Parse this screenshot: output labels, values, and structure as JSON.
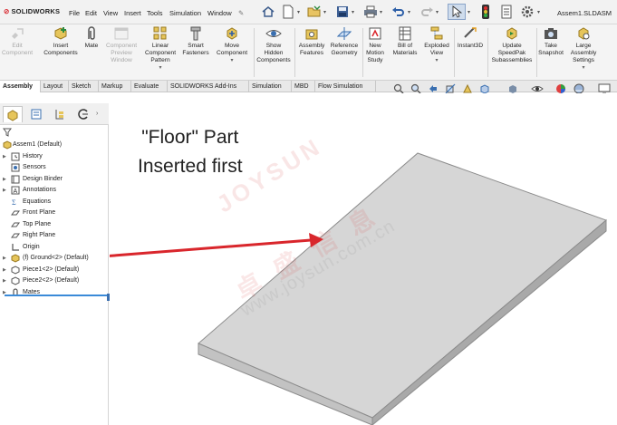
{
  "app": {
    "logo_text": "SOLIDWORKS",
    "document_title": "Assem1.SLDASM"
  },
  "menu": [
    "File",
    "Edit",
    "View",
    "Insert",
    "Tools",
    "Simulation",
    "Window"
  ],
  "ribbon": {
    "commands": [
      {
        "label": "Edit\nComponent",
        "enabled": false
      },
      {
        "label": "Insert\nComponents",
        "enabled": true
      },
      {
        "label": "Mate",
        "enabled": true
      },
      {
        "label": "Component\nPreview\nWindow",
        "enabled": false
      },
      {
        "label": "Linear\nComponent\nPattern",
        "enabled": true
      },
      {
        "label": "Smart\nFasteners",
        "enabled": true
      },
      {
        "label": "Move\nComponent",
        "enabled": true
      },
      {
        "label": "Show\nHidden\nComponents",
        "enabled": true
      },
      {
        "label": "Assembly\nFeatures",
        "enabled": true
      },
      {
        "label": "Reference\nGeometry",
        "enabled": true
      },
      {
        "label": "New\nMotion\nStudy",
        "enabled": true
      },
      {
        "label": "Bill of\nMaterials",
        "enabled": true
      },
      {
        "label": "Exploded\nView",
        "enabled": true
      },
      {
        "label": "Instant3D",
        "enabled": true
      },
      {
        "label": "Update\nSpeedPak\nSubassemblies",
        "enabled": true
      },
      {
        "label": "Take\nSnapshot",
        "enabled": true
      },
      {
        "label": "Large\nAssembly\nSettings",
        "enabled": true
      }
    ]
  },
  "tabs": [
    {
      "label": "Assembly",
      "active": true
    },
    {
      "label": "Layout",
      "active": false
    },
    {
      "label": "Sketch",
      "active": false
    },
    {
      "label": "Markup",
      "active": false
    },
    {
      "label": "Evaluate",
      "active": false
    },
    {
      "label": "SOLIDWORKS Add-Ins",
      "active": false
    },
    {
      "label": "Simulation",
      "active": false
    },
    {
      "label": "MBD",
      "active": false
    },
    {
      "label": "Flow Simulation",
      "active": false
    }
  ],
  "feature_tree": [
    {
      "label": "Assem1  (Default)",
      "icon": "assembly-icon",
      "expander": false
    },
    {
      "label": "History",
      "icon": "history-icon",
      "expander": true
    },
    {
      "label": "Sensors",
      "icon": "sensor-icon",
      "expander": false
    },
    {
      "label": "Design Binder",
      "icon": "binder-icon",
      "expander": true
    },
    {
      "label": "Annotations",
      "icon": "annotation-icon",
      "expander": true
    },
    {
      "label": "Equations",
      "icon": "equation-icon",
      "expander": false
    },
    {
      "label": "Front Plane",
      "icon": "plane-icon",
      "expander": false
    },
    {
      "label": "Top Plane",
      "icon": "plane-icon",
      "expander": false
    },
    {
      "label": "Right Plane",
      "icon": "plane-icon",
      "expander": false
    },
    {
      "label": "Origin",
      "icon": "origin-icon",
      "expander": false
    },
    {
      "label": "(f) Ground<2> (Default)",
      "icon": "fixed-part-icon",
      "expander": true
    },
    {
      "label": "Piece1<2> (Default)",
      "icon": "part-icon",
      "expander": true
    },
    {
      "label": "Piece2<2> (Default)",
      "icon": "part-icon",
      "expander": true
    },
    {
      "label": "Mates",
      "icon": "mates-icon",
      "expander": true
    }
  ],
  "annotation": {
    "line1": "\"Floor\" Part",
    "line2": "Inserted first",
    "arrow_color": "#d9262c"
  },
  "watermark": {
    "text1": "JOYSUN",
    "text2": "卓 盛 信 息",
    "text3": "www.joysun.com.cn"
  },
  "colors": {
    "accent": "#3a8ad8",
    "brand": "#d8262e",
    "part_top": "#d6d6d6",
    "part_side": "#a9a9a9",
    "part_front": "#c2c2c2"
  }
}
